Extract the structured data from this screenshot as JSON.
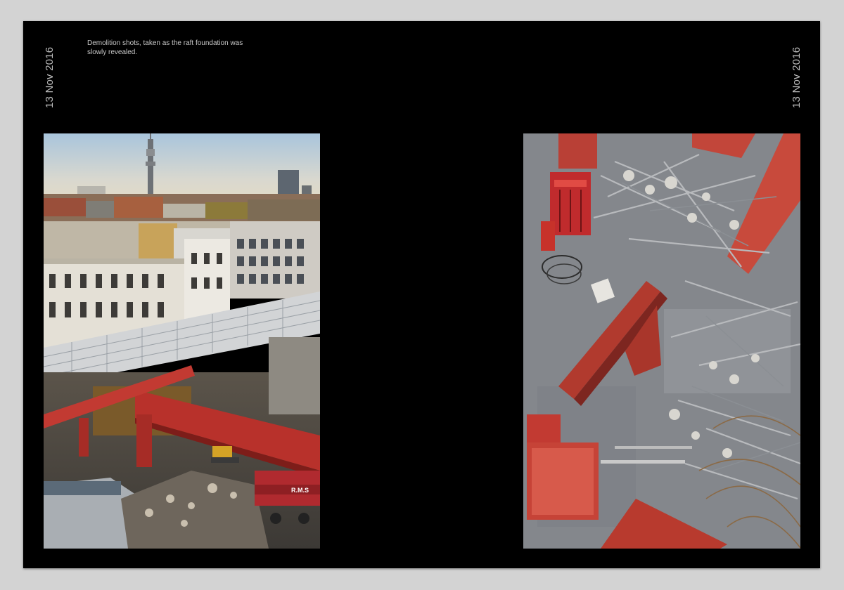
{
  "page": {
    "caption": "Demolition shots, taken as the raft foundation was slowly revealed.",
    "date_left": "13 Nov 2016",
    "date_right": "13 Nov 2016",
    "truck_text": "R.M.S"
  },
  "photos": [
    {
      "description": "demolition-site-with-red-steel-beams-and-london-skyline"
    },
    {
      "description": "overhead-view-of-rubble-rebar-and-red-steel-plates"
    }
  ]
}
